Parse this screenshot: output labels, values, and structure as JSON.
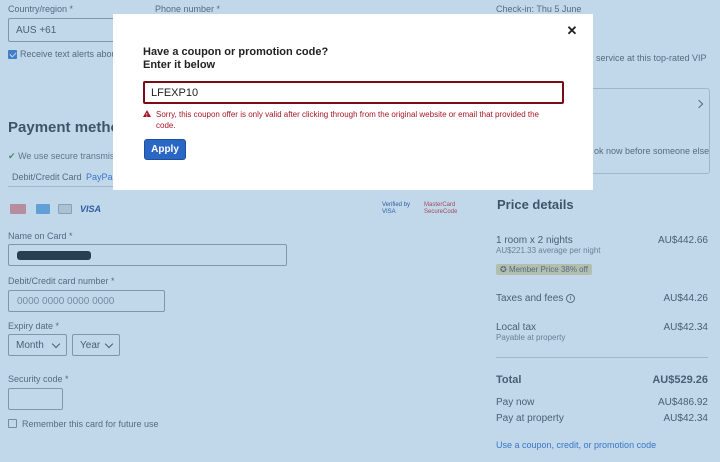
{
  "contact": {
    "country_label": "Country/region *",
    "country_value": "AUS +61",
    "phone_label": "Phone number *",
    "alerts_label": "Receive text alerts about t"
  },
  "payment": {
    "heading": "Payment metho",
    "secure_note": "We use secure transmissi",
    "tabs": [
      "Debit/Credit Card",
      "PayPal"
    ],
    "card_brands": [
      "Mastercard",
      "Amex",
      "Diners",
      "VISA"
    ],
    "verified_by": "Verified by\nVISA",
    "securecode": "MasterCard\nSecureCode",
    "name_label": "Name on Card *",
    "number_label": "Debit/Credit card number *",
    "number_placeholder": "0000 0000 0000 0000",
    "expiry_label": "Expiry date *",
    "month": "Month",
    "year": "Year",
    "security_label": "Security code *",
    "remember_label": "Remember this card for future use"
  },
  "sidebar": {
    "checkin": "Check-in: Thu 5 June",
    "vip_note": "service at this top-rated VIP",
    "book_note": "ok now before someone else"
  },
  "price": {
    "heading": "Price details",
    "room_label": "1 room x 2 nights",
    "room_sub": "AU$221.33 average per night",
    "room_value": "AU$442.66",
    "member_badge": "Member Price 38% off",
    "taxes_label": "Taxes and fees",
    "taxes_value": "AU$44.26",
    "local_tax_label": "Local tax",
    "local_tax_sub": "Payable at property",
    "local_tax_value": "AU$42.34",
    "total_label": "Total",
    "total_value": "AU$529.26",
    "pay_now_label": "Pay now",
    "pay_now_value": "AU$486.92",
    "pay_prop_label": "Pay at property",
    "pay_prop_value": "AU$42.34",
    "coupon_link": "Use a coupon, credit, or promotion code"
  },
  "modal": {
    "title_line1": "Have a coupon or promotion code?",
    "title_line2": "Enter it below",
    "code_value": "LFEXP10",
    "error": "Sorry, this coupon offer is only valid after clicking through from the original website or email that provided the code.",
    "apply_label": "Apply",
    "close_icon": "close-icon"
  },
  "colors": {
    "overlay": "#5494c8",
    "error": "#a51625",
    "input_border_error": "#7a0c16",
    "apply_button": "#2a67c5"
  }
}
